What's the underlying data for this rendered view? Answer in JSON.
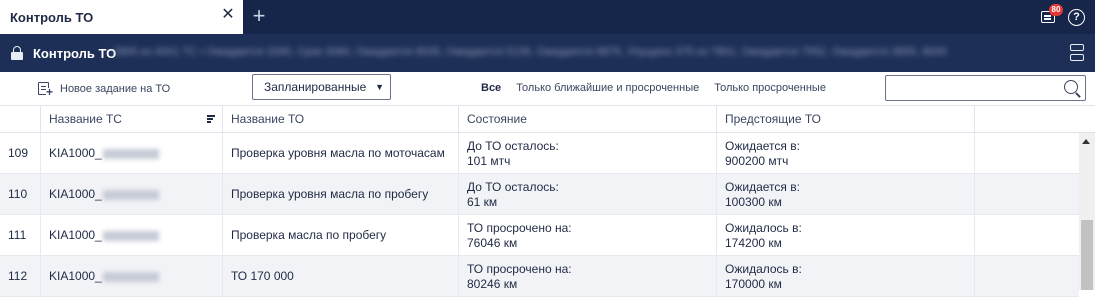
{
  "tab": {
    "title": "Контроль ТО",
    "close": "✕",
    "add": "+"
  },
  "notifications": {
    "count": "80"
  },
  "header": {
    "title": "Контроль ТО",
    "summary_blurred": "2865 из 4001 ТС • Ожидается 3345, Срок 3060, Ожидается 8035, Ожидается 5135, Ожидается 8875, Упущено 375 из 7801, Ожидается 7552, Ожидается 3855, 8005"
  },
  "toolbar": {
    "new_task_label": "Новое задание на ТО",
    "select_value": "Запланированные",
    "filters": [
      "Все",
      "Только ближайшие и просроченные",
      "Только просроченные"
    ],
    "active_filter": "Все",
    "search_placeholder": ""
  },
  "table": {
    "columns": [
      "Название ТС",
      "Название ТО",
      "Состояние",
      "Предстоящие ТО"
    ],
    "rows": [
      {
        "num": "109",
        "ts": "KIA1000_",
        "to": "Проверка уровня масла по моточасам",
        "state_label": "До ТО осталось:",
        "state_value": "101 мтч",
        "next_label": "Ожидается в:",
        "next_value": "900200 мтч"
      },
      {
        "num": "110",
        "ts": "KIA1000_",
        "to": "Проверка уровня масла по пробегу",
        "state_label": "До ТО осталось:",
        "state_value": "61 км",
        "next_label": "Ожидается в:",
        "next_value": "100300 км"
      },
      {
        "num": "111",
        "ts": "KIA1000_",
        "to": "Проверка масла по пробегу",
        "state_label": "ТО просрочено на:",
        "state_value": "76046 км",
        "next_label": "Ожидалось в:",
        "next_value": "174200 км"
      },
      {
        "num": "112",
        "ts": "KIA1000_",
        "to": "ТО 170 000",
        "state_label": "ТО просрочено на:",
        "state_value": "80246 км",
        "next_label": "Ожидалось в:",
        "next_value": "170000 км"
      }
    ]
  },
  "colors": {
    "tabbar": "#16264a",
    "titlebar": "#1d2f57",
    "badge": "#e53935",
    "row_alt": "#f2f3f6"
  }
}
